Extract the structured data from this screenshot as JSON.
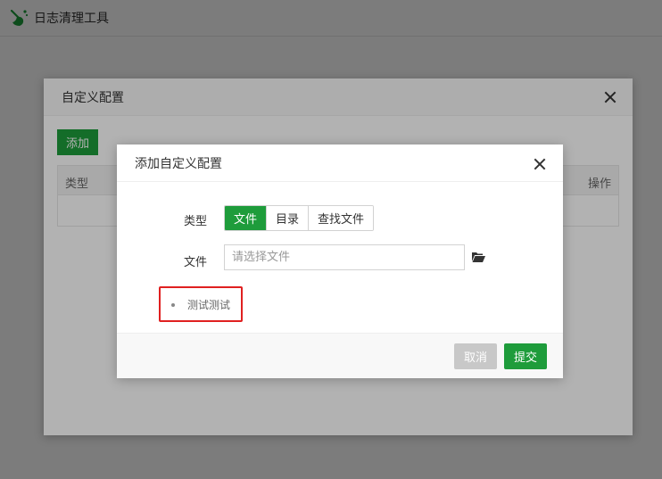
{
  "app": {
    "title": "日志清理工具",
    "logo_icon": "broom-icon",
    "accent_color": "#1e9c3b"
  },
  "outer_dialog": {
    "title": "自定义配置",
    "add_label": "添加",
    "table": {
      "columns": [
        "类型",
        "操作"
      ]
    }
  },
  "inner_dialog": {
    "title": "添加自定义配置",
    "type_label": "类型",
    "type_options": [
      "文件",
      "目录",
      "查找文件"
    ],
    "type_selected": "文件",
    "file_label": "文件",
    "file_placeholder": "请选择文件",
    "file_value": "",
    "folder_icon": "folder-open-icon",
    "list_items": [
      "测试测试"
    ],
    "cancel_label": "取消",
    "submit_label": "提交"
  }
}
